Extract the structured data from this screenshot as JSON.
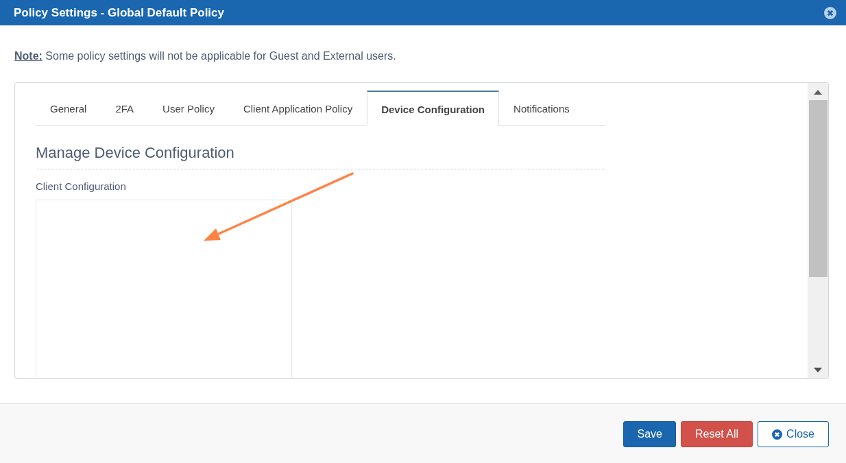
{
  "window": {
    "title": "Policy Settings - Global Default Policy"
  },
  "note": "**Note:** Some policy settings will not be applicable for Guest and External users.",
  "tabs": [
    {
      "label": "General",
      "selected": false
    },
    {
      "label": "2FA",
      "selected": false
    },
    {
      "label": "User Policy",
      "selected": false
    },
    {
      "label": "Client Application Policy",
      "selected": false
    },
    {
      "label": "Device Configuration",
      "selected": true
    },
    {
      "label": "Notifications",
      "selected": false
    }
  ],
  "section": {
    "heading": "Manage Device Configuration",
    "label": "Client Configuration"
  },
  "buttons": [
    {
      "label": "Save",
      "kind": "primary"
    },
    {
      "label": "Reset All",
      "kind": "danger"
    },
    {
      "label": "Close",
      "kind": "outline"
    }
  ]
}
